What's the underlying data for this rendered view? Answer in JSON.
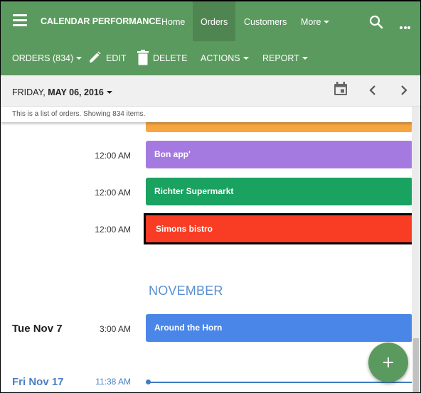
{
  "app": {
    "title": "CALENDAR PERFORMANCE",
    "nav": [
      {
        "label": "Home",
        "active": false
      },
      {
        "label": "Orders",
        "active": true
      },
      {
        "label": "Customers",
        "active": false
      },
      {
        "label": "More",
        "active": false
      }
    ],
    "icons": {
      "menu": "hamburger-icon",
      "search": "search-icon",
      "more": "ellipsis-icon"
    }
  },
  "toolbar": {
    "orders_label": "ORDERS (834)",
    "edit_label": "EDIT",
    "delete_label": "DELETE",
    "actions_label": "ACTIONS",
    "report_label": "REPORT"
  },
  "datebar": {
    "weekday": "FRIDAY,",
    "date": "MAY 06, 2016",
    "icons": {
      "calendar": "calendar-icon",
      "prev": "chevron-left-icon",
      "next": "chevron-right-icon"
    }
  },
  "info": {
    "text": "This is a list of orders. Showing 834 items."
  },
  "colors": {
    "brand": "#5b9a5e",
    "brand_active": "#4f8551",
    "accent_blue": "#4a7fc1"
  },
  "agenda": {
    "events": [
      {
        "time": "",
        "title": "",
        "color": "#f7a540",
        "partial": true
      },
      {
        "time": "12:00 AM",
        "title": "Bon app'",
        "color": "#a57ae0"
      },
      {
        "time": "12:00 AM",
        "title": "Richter Supermarkt",
        "color": "#1aa260"
      },
      {
        "time": "12:00 AM",
        "title": "Simons bistro",
        "color": "#f93c24",
        "selected": true
      }
    ],
    "month_header": "NOVEMBER",
    "november": [
      {
        "day": "Tue Nov 7",
        "time": "3:00 AM",
        "title": "Around the Horn",
        "color": "#4a86e8"
      },
      {
        "day": "Fri Nov 17",
        "time": "11:38 AM",
        "now_indicator": true
      }
    ]
  },
  "fab": {
    "icon": "plus-icon"
  }
}
